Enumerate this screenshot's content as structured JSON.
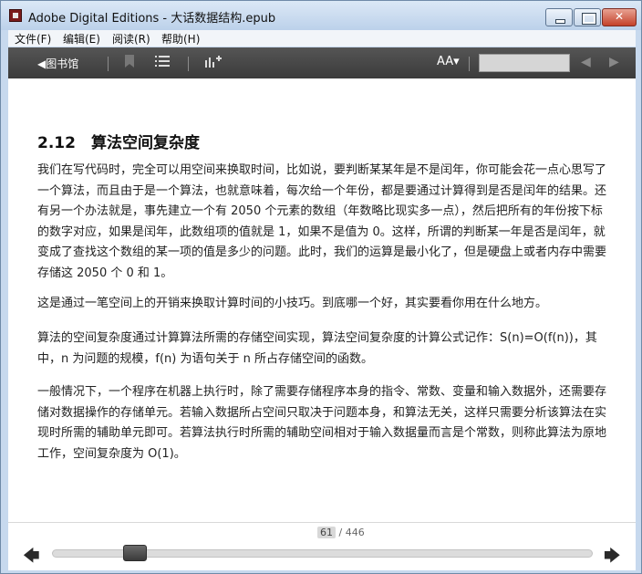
{
  "window": {
    "title": "Adobe Digital Editions - 大话数据结构.epub",
    "controls": {
      "minimize": "",
      "maximize": "",
      "close": "✕"
    }
  },
  "menu": {
    "items": [
      "文件(F)",
      "编辑(E)",
      "阅读(R)",
      "帮助(H)"
    ]
  },
  "toolbar": {
    "library_label": "◀图书馆",
    "font_size_label": "AA▾",
    "search_value": "",
    "icons": [
      "bookmark-icon",
      "list-icon",
      "chart-icon",
      "prev-arrow-icon",
      "next-arrow-icon"
    ]
  },
  "content": {
    "section_title": "2.12　算法空间复杂度",
    "paragraphs": [
      "我们在写代码时，完全可以用空间来换取时间，比如说，要判断某某年是不是闰年，你可能会花一点心思写了一个算法，而且由于是一个算法，也就意味着，每次给一个年份，都是要通过计算得到是否是闰年的结果。还有另一个办法就是，事先建立一个有 2050 个元素的数组（年数略比现实多一点），然后把所有的年份按下标的数字对应，如果是闰年，此数组项的值就是 1，如果不是值为 0。这样，所谓的判断某一年是否是闰年，就变成了查找这个数组的某一项的值是多少的问题。此时，我们的运算是最小化了，但是硬盘上或者内存中需要存储这 2050 个 0 和 1。",
      "这是通过一笔空间上的开销来换取计算时间的小技巧。到底哪一个好，其实要看你用在什么地方。",
      "算法的空间复杂度通过计算算法所需的存储空间实现，算法空间复杂度的计算公式记作：S(n)=O(f(n))，其中，n 为问题的规模，f(n) 为语句关于 n 所占存储空间的函数。",
      "一般情况下，一个程序在机器上执行时，除了需要存储程序本身的指令、常数、变量和输入数据外，还需要存储对数据操作的存储单元。若输入数据所占空间只取决于问题本身，和算法无关，这样只需要分析该算法在实现时所需的辅助单元即可。若算法执行时所需的辅助空间相对于输入数据量而言是个常数，则称此算法为原地工作，空间复杂度为 O(1)。"
    ]
  },
  "footer": {
    "current_page": "61",
    "total_pages": "/ 446",
    "progress_fraction": 0.137,
    "prev_label": "🡄",
    "next_label": "🡆"
  }
}
